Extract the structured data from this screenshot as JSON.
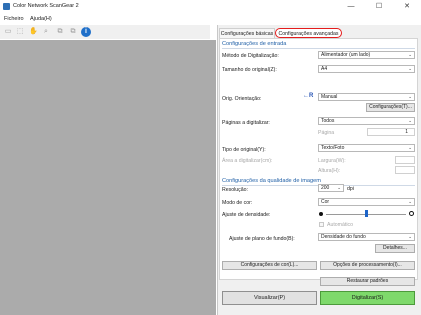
{
  "window": {
    "title": "Color Network ScanGear 2",
    "minimize": "—",
    "maximize": "☐",
    "close": "✕"
  },
  "menu": [
    "Ficheiro",
    "Ajuda(H)"
  ],
  "tabs": {
    "basic": "Configurações básicas",
    "advanced": "Configurações avançadas"
  },
  "input_section": {
    "title": "Configurações de entrada",
    "scan_method_label": "Método de Digitalização:",
    "scan_method_value": "Alimentador (um lado)",
    "original_size_label": "Tamanho do original(Z):",
    "original_size_value": "A4",
    "orientation_label": "Orig. Orientação:",
    "orientation_value": "Manual",
    "orientation_settings_button": "Configurações(T)...",
    "pages_label": "Páginas a digitalizar:",
    "pages_value": "Todos",
    "page_number_label": "Página",
    "page_number_value": "1",
    "original_type_label": "Tipo de original(Y):",
    "original_type_value": "Texto/Foto",
    "scan_area_label": "Área a digitalizar(cm):",
    "width_label": "Largura(W):",
    "height_label": "Altura(H):"
  },
  "quality_section": {
    "title": "Configurações da qualidade de imagem",
    "resolution_label": "Resolução:",
    "resolution_value": "200",
    "resolution_unit": "dpi",
    "color_mode_label": "Modo de cor:",
    "color_mode_value": "Cor",
    "density_label": "Ajuste de densidade:",
    "density_level": 0.5,
    "auto_label": "Automático",
    "background_label": "Ajuste de plano de fundo(B):",
    "background_value": "Densidade do fundo",
    "details_button": "Detalhes..."
  },
  "buttons": {
    "color_settings": "Configurações de cor(L)...",
    "processing_options": "Opções de processamento(I)...",
    "restore_defaults": "Restaurar padrões",
    "preview": "Visualizar(P)",
    "scan": "Digitalizar(S)"
  }
}
